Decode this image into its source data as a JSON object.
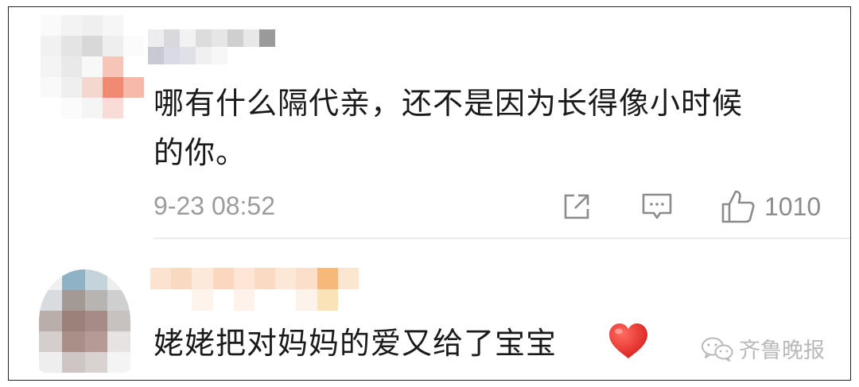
{
  "comments": [
    {
      "text_line1": "哪有什么隔代亲，还不是因为长得像小时候",
      "text_line2": "的你。",
      "timestamp": "9-23 08:52",
      "like_count": "1010"
    },
    {
      "text": "姥姥把对妈妈的爱又给了宝宝"
    }
  ],
  "watermark": {
    "label": "齐鲁晚报"
  },
  "icons": {
    "share": "share-icon",
    "reply": "comment-icon",
    "like": "thumbs-up-icon",
    "heart": "heart-emoji-icon",
    "wechat": "wechat-logo-icon"
  },
  "colors": {
    "text": "#1a1a1a",
    "meta": "#9c9c9c",
    "heart": "#e53935"
  }
}
